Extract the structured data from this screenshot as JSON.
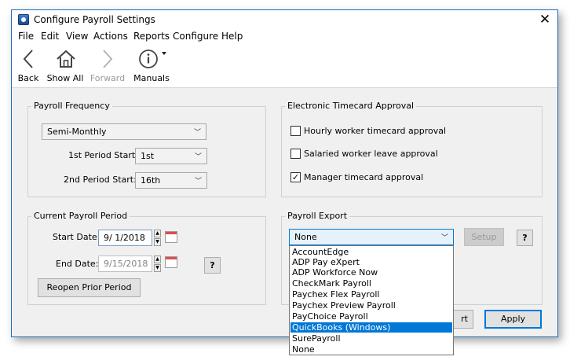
{
  "window": {
    "title": "Configure Payroll Settings"
  },
  "menu": [
    "File",
    "Edit",
    "View",
    "Actions",
    "Reports",
    "Configure",
    "Help"
  ],
  "toolbar": {
    "back": "Back",
    "show_all": "Show All",
    "forward": "Forward",
    "manuals": "Manuals"
  },
  "payroll_frequency": {
    "title": "Payroll Frequency",
    "frequency_value": "Semi-Monthly",
    "first_period_label": "1st Period Start:",
    "first_period_value": "1st",
    "second_period_label": "2nd Period Start:",
    "second_period_value": "16th"
  },
  "timecard_approval": {
    "title": "Electronic Timecard Approval",
    "items": [
      {
        "label": "Hourly worker timecard approval",
        "checked": false
      },
      {
        "label": "Salaried worker leave approval",
        "checked": false
      },
      {
        "label": "Manager timecard approval",
        "checked": true
      }
    ]
  },
  "current_period": {
    "title": "Current Payroll Period",
    "start_label": "Start Date:",
    "start_value": "9/  1/2018",
    "end_label": "End Date:",
    "end_value": "9/15/2018",
    "help": "?",
    "reopen": "Reopen Prior Period"
  },
  "payroll_export": {
    "title": "Payroll Export",
    "selected": "None",
    "setup": "Setup",
    "help": "?",
    "options": [
      "AccountEdge",
      "ADP Pay eXpert",
      "ADP Workforce Now",
      "CheckMark Payroll",
      "Paychex Flex Payroll",
      "Paychex Preview Payroll",
      "PayChoice Payroll",
      "QuickBooks (Windows)",
      "SurePayroll",
      "None"
    ],
    "highlighted": "QuickBooks (Windows)"
  },
  "buttons": {
    "partial": "rt",
    "apply": "Apply"
  },
  "colors": {
    "accent": "#0078d7",
    "border": "#1f6fbf"
  }
}
